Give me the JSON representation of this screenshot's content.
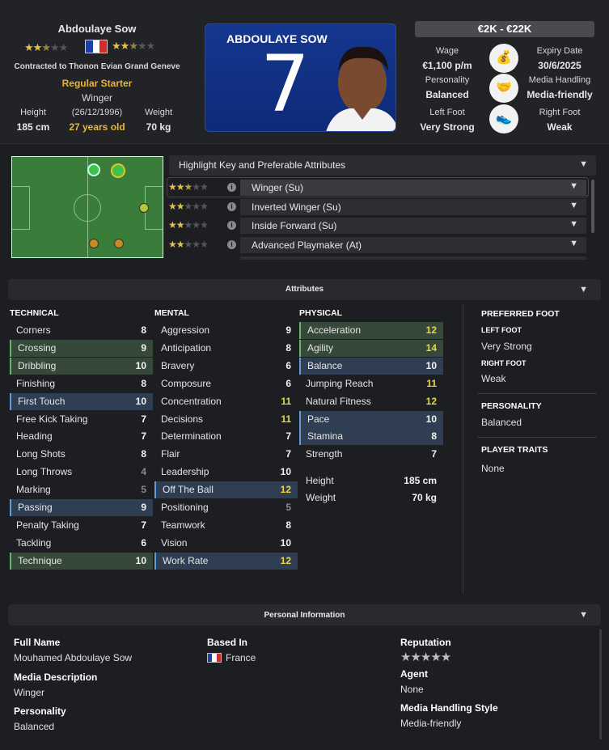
{
  "player": {
    "name": "Abdoulaye Sow",
    "contract": "Contracted to Thonon Evian Grand Geneve",
    "squad_status": "Regular Starter",
    "position": "Winger",
    "dob": "(26/12/1996)",
    "age": "27 years old",
    "height_label": "Height",
    "height": "185 cm",
    "weight_label": "Weight",
    "weight": "70 kg",
    "current_ability_stars": 2.5,
    "potential_ability_stars": 2.5,
    "nationality_flag": "france-flag-icon"
  },
  "card": {
    "name": "ABDOULAYE SOW",
    "number": "7"
  },
  "contract": {
    "value": "€2K - €22K",
    "wage_label": "Wage",
    "wage": "€1,100 p/m",
    "expiry_label": "Expiry Date",
    "expiry": "30/6/2025",
    "personality_label": "Personality",
    "personality": "Balanced",
    "media_label": "Media Handling",
    "media": "Media-friendly",
    "left_foot_label": "Left Foot",
    "left_foot": "Very Strong",
    "right_foot_label": "Right Foot",
    "right_foot": "Weak"
  },
  "roles": {
    "header": "Highlight Key and Preferable Attributes",
    "items": [
      {
        "label": "Winger (Su)",
        "stars": 2.5
      },
      {
        "label": "Inverted Winger (Su)",
        "stars": 2
      },
      {
        "label": "Inside Forward (Su)",
        "stars": 2
      },
      {
        "label": "Advanced Playmaker (At)",
        "stars": 2
      }
    ]
  },
  "attributes": {
    "title": "Attributes",
    "technical": {
      "title": "TECHNICAL",
      "items": [
        [
          "Corners",
          "8"
        ],
        [
          "Crossing",
          "9"
        ],
        [
          "Dribbling",
          "10"
        ],
        [
          "Finishing",
          "8"
        ],
        [
          "First Touch",
          "10"
        ],
        [
          "Free Kick Taking",
          "7"
        ],
        [
          "Heading",
          "7"
        ],
        [
          "Long Shots",
          "8"
        ],
        [
          "Long Throws",
          "4"
        ],
        [
          "Marking",
          "5"
        ],
        [
          "Passing",
          "9"
        ],
        [
          "Penalty Taking",
          "7"
        ],
        [
          "Tackling",
          "6"
        ],
        [
          "Technique",
          "10"
        ]
      ]
    },
    "mental": {
      "title": "MENTAL",
      "items": [
        [
          "Aggression",
          "9"
        ],
        [
          "Anticipation",
          "8"
        ],
        [
          "Bravery",
          "6"
        ],
        [
          "Composure",
          "6"
        ],
        [
          "Concentration",
          "11"
        ],
        [
          "Decisions",
          "11"
        ],
        [
          "Determination",
          "7"
        ],
        [
          "Flair",
          "7"
        ],
        [
          "Leadership",
          "10"
        ],
        [
          "Off The Ball",
          "12"
        ],
        [
          "Positioning",
          "5"
        ],
        [
          "Teamwork",
          "8"
        ],
        [
          "Vision",
          "10"
        ],
        [
          "Work Rate",
          "12"
        ]
      ]
    },
    "physical": {
      "title": "PHYSICAL",
      "items": [
        [
          "Acceleration",
          "12"
        ],
        [
          "Agility",
          "14"
        ],
        [
          "Balance",
          "10"
        ],
        [
          "Jumping Reach",
          "11"
        ],
        [
          "Natural Fitness",
          "12"
        ],
        [
          "Pace",
          "10"
        ],
        [
          "Stamina",
          "8"
        ],
        [
          "Strength",
          "7"
        ]
      ]
    },
    "extra": [
      [
        "Height",
        "185 cm"
      ],
      [
        "Weight",
        "70 kg"
      ]
    ]
  },
  "side": {
    "pref_foot_h": "PREFERRED FOOT",
    "left_h": "LEFT FOOT",
    "left_v": "Very Strong",
    "right_h": "RIGHT FOOT",
    "right_v": "Weak",
    "pers_h": "PERSONALITY",
    "pers_v": "Balanced",
    "traits_h": "PLAYER TRAITS",
    "traits_v": "None"
  },
  "personal": {
    "title": "Personal Information",
    "full_name_h": "Full Name",
    "full_name": "Mouhamed Abdoulaye Sow",
    "media_desc_h": "Media Description",
    "media_desc": "Winger",
    "personality_h": "Personality",
    "personality": "Balanced",
    "based_h": "Based In",
    "based": "France",
    "rep_h": "Reputation",
    "agent_h": "Agent",
    "agent": "None",
    "mhs_h": "Media Handling Style",
    "mhs": "Media-friendly"
  },
  "colors": {
    "green_hl": "#35483a",
    "blue_hl": "#2f3e52",
    "yellow_value": "#e7d84a",
    "gold": "#e8b53a"
  }
}
